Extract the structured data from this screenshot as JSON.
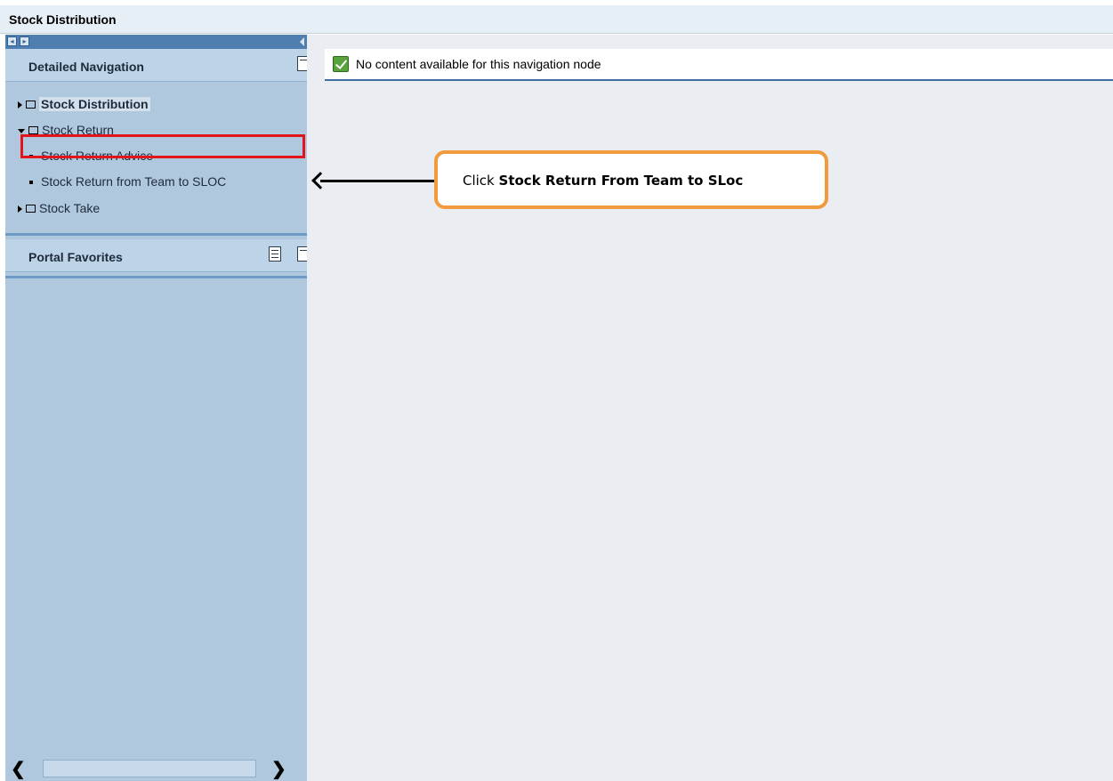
{
  "window": {
    "title": "Stock Distribution"
  },
  "left_panel": {
    "detailed_navigation": {
      "title": "Detailed Navigation",
      "items": [
        {
          "label": "Stock Distribution",
          "expanded": false,
          "bold": true
        },
        {
          "label": "Stock Return",
          "expanded": true
        },
        {
          "label": "Stock Return Advice"
        },
        {
          "label": "Stock Return from Team to SLOC",
          "highlighted": true
        },
        {
          "label": "Stock Take",
          "expanded": false
        }
      ]
    },
    "portal_favorites": {
      "title": "Portal Favorites"
    }
  },
  "content": {
    "message": "No content available for this navigation node",
    "message_status_icon": "green-check-icon"
  },
  "annotation": {
    "prefix": "Click",
    "target": "Stock Return From Team to SLoc",
    "callout_border_color": "#f29a3e",
    "highlight_color": "#e3141c"
  }
}
